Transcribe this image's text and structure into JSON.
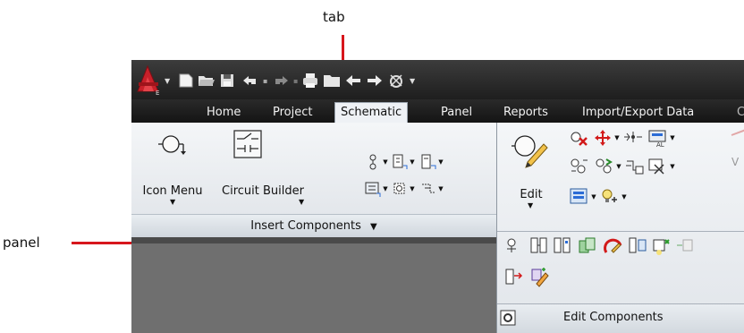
{
  "callouts": {
    "tab_label": "tab",
    "panel_label": "panel"
  },
  "quick_access": {
    "app_button_letter": "E",
    "icons": [
      "new-icon",
      "open-icon",
      "save-icon",
      "undo-icon",
      "redo-icon",
      "print-icon",
      "folder-icon",
      "back-arrow-icon",
      "forward-arrow-icon",
      "workspace-icon",
      "qat-dropdown-icon"
    ]
  },
  "tabs": [
    "Home",
    "Project",
    "Schematic",
    "Panel",
    "Reports",
    "Import/Export Data",
    "C"
  ],
  "active_tab": "Schematic",
  "insert_panel": {
    "title": "Insert Components",
    "icon_menu_label": "Icon Menu",
    "circuit_builder_label": "Circuit Builder"
  },
  "edit_panel": {
    "edit_label": "Edit",
    "title": "Edit Components"
  },
  "colors": {
    "callout_red": "#d7161c",
    "app_button": "#c8202a",
    "tab_bar": "#1e1e1e",
    "ribbon_bg": "#eef1f5"
  }
}
